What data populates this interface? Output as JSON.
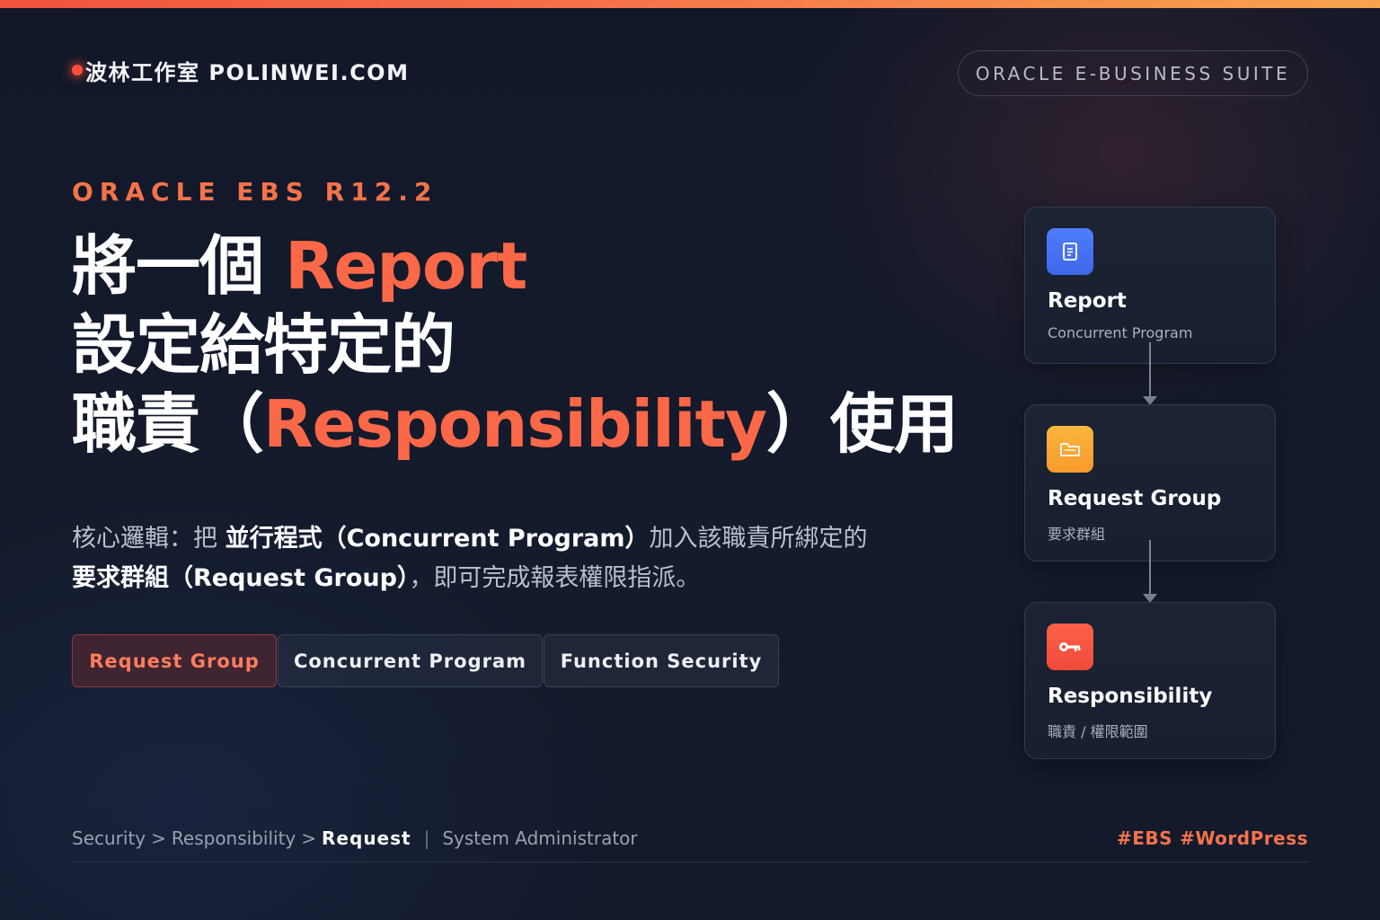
{
  "header": {
    "brand": "波林工作室 POLINWEI.COM",
    "suite": "ORACLE E-BUSINESS SUITE"
  },
  "hero": {
    "eyebrow": "ORACLE EBS R12.2",
    "line1_prefix": "將一個 ",
    "line1_accent": "Report",
    "line2": "設定給特定的",
    "line3_prefix": "職責（",
    "line3_accent": "Responsibility",
    "line3_suffix": "）使用"
  },
  "lead": {
    "part1": "核心邏輯：把 ",
    "strong1": "並行程式（Concurrent Program）",
    "part2": "加入該職責所綁定的",
    "strong2": "要求群組（Request Group）",
    "part3": "，即可完成報表權限指派。"
  },
  "chips": [
    {
      "label": "Request Group",
      "active": true
    },
    {
      "label": "Concurrent Program",
      "active": false
    },
    {
      "label": "Function Security",
      "active": false
    }
  ],
  "flow": [
    {
      "title": "Report",
      "subtitle": "Concurrent Program",
      "icon": "document-icon",
      "color": "#4f7dfc"
    },
    {
      "title": "Request Group",
      "subtitle": "要求群組",
      "icon": "folder-icon",
      "color": "#f9a835"
    },
    {
      "title": "Responsibility",
      "subtitle": "職責 / 權限範圍",
      "icon": "key-icon",
      "color": "#f85640"
    }
  ],
  "footer": {
    "crumbs": [
      "Security",
      "Responsibility",
      "Request"
    ],
    "separator": ">",
    "pipe": "|",
    "context": "System Administrator",
    "tags": [
      "#EBS",
      "#WordPress"
    ]
  },
  "colors": {
    "accent": "#fb6848",
    "background": "#141b2d"
  }
}
